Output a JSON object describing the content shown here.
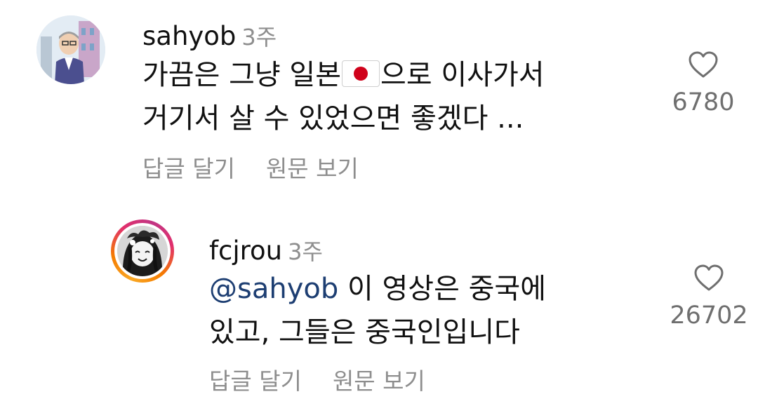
{
  "comments": [
    {
      "username": "sahyob",
      "time": "3주",
      "mention": "",
      "line1_before_flag": "가끔은 그냥 일본",
      "line1_after_flag": "으로 이사가서",
      "line2": "거기서 살 수 있었으면 좋겠다 ...",
      "reply_label": "답글 달기",
      "translate_label": "원문 보기",
      "likes": "6780",
      "flag_icon": "japan-flag-icon"
    },
    {
      "username": "fcjrou",
      "time": "3주",
      "mention": "@sahyob",
      "line1_after_mention": " 이 영상은 중국에",
      "line2": "있고, 그들은 중국인입니다",
      "reply_label": "답글 달기",
      "translate_label": "원문 보기",
      "likes": "26702"
    }
  ],
  "colors": {
    "text": "#111111",
    "muted": "#8e8e8e",
    "mention": "#1d3e72",
    "story_ring_start": "#f9a825",
    "story_ring_end": "#c13584"
  },
  "icons": {
    "like": "heart-outline-icon"
  }
}
